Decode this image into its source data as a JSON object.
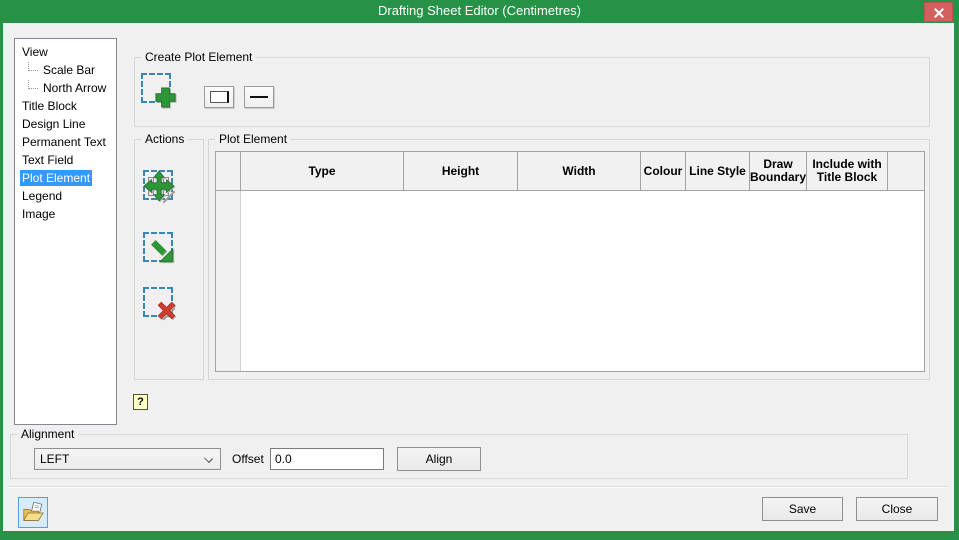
{
  "window": {
    "title": "Drafting Sheet Editor (Centimetres)"
  },
  "colors": {
    "titlebar_green": "#259247",
    "close_button_red": "#D2605E",
    "selection_blue": "#3399FF",
    "dashed_icon_blue": "#3887B0",
    "icon_green": "#2C9639",
    "icon_red": "#D03B2F"
  },
  "sidebar": {
    "items": [
      {
        "label": "View",
        "level": 0,
        "selected": false
      },
      {
        "label": "Scale Bar",
        "level": 1,
        "selected": false
      },
      {
        "label": "North Arrow",
        "level": 1,
        "selected": false
      },
      {
        "label": "Title Block",
        "level": 0,
        "selected": false
      },
      {
        "label": "Design Line",
        "level": 0,
        "selected": false
      },
      {
        "label": "Permanent Text",
        "level": 0,
        "selected": false
      },
      {
        "label": "Text Field",
        "level": 0,
        "selected": false
      },
      {
        "label": "Plot Element",
        "level": 0,
        "selected": true
      },
      {
        "label": "Legend",
        "level": 0,
        "selected": false
      },
      {
        "label": "Image",
        "level": 0,
        "selected": false
      }
    ]
  },
  "create_plot_element": {
    "title": "Create Plot Element"
  },
  "actions": {
    "title": "Actions"
  },
  "plot_element": {
    "title": "Plot Element",
    "columns": [
      "",
      "Type",
      "Height",
      "Width",
      "Colour",
      "Line Style",
      "Draw Boundary",
      "Include with Title Block",
      ""
    ],
    "rows": []
  },
  "help": {
    "glyph": "?"
  },
  "alignment": {
    "title": "Alignment",
    "selected_value": "LEFT",
    "offset_label": "Offset",
    "offset_value": "0.0",
    "align_button_label": "Align"
  },
  "footer": {
    "save_label": "Save",
    "close_label": "Close"
  }
}
